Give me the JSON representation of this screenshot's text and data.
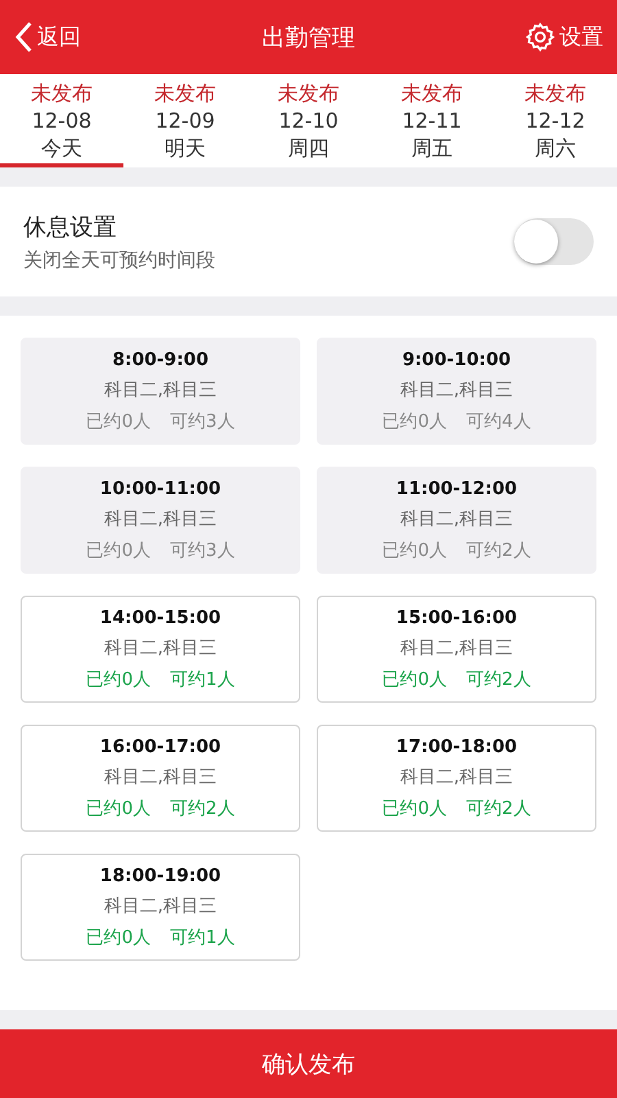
{
  "header": {
    "back": "返回",
    "title": "出勤管理",
    "settings": "设置"
  },
  "days": [
    {
      "status": "未发布",
      "date": "12-08",
      "weekday": "今天",
      "selected": true
    },
    {
      "status": "未发布",
      "date": "12-09",
      "weekday": "明天",
      "selected": false
    },
    {
      "status": "未发布",
      "date": "12-10",
      "weekday": "周四",
      "selected": false
    },
    {
      "status": "未发布",
      "date": "12-11",
      "weekday": "周五",
      "selected": false
    },
    {
      "status": "未发布",
      "date": "12-12",
      "weekday": "周六",
      "selected": false
    }
  ],
  "rest": {
    "title": "休息设置",
    "subtitle": "关闭全天可预约时间段",
    "on": false
  },
  "slots": [
    {
      "time": "8:00-9:00",
      "subjects": "科目二,科目三",
      "booked": "已约0人",
      "available": "可约3人",
      "disabled": true
    },
    {
      "time": "9:00-10:00",
      "subjects": "科目二,科目三",
      "booked": "已约0人",
      "available": "可约4人",
      "disabled": true
    },
    {
      "time": "10:00-11:00",
      "subjects": "科目二,科目三",
      "booked": "已约0人",
      "available": "可约3人",
      "disabled": true
    },
    {
      "time": "11:00-12:00",
      "subjects": "科目二,科目三",
      "booked": "已约0人",
      "available": "可约2人",
      "disabled": true
    },
    {
      "time": "14:00-15:00",
      "subjects": "科目二,科目三",
      "booked": "已约0人",
      "available": "可约1人",
      "disabled": false
    },
    {
      "time": "15:00-16:00",
      "subjects": "科目二,科目三",
      "booked": "已约0人",
      "available": "可约2人",
      "disabled": false
    },
    {
      "time": "16:00-17:00",
      "subjects": "科目二,科目三",
      "booked": "已约0人",
      "available": "可约2人",
      "disabled": false
    },
    {
      "time": "17:00-18:00",
      "subjects": "科目二,科目三",
      "booked": "已约0人",
      "available": "可约2人",
      "disabled": false
    },
    {
      "time": "18:00-19:00",
      "subjects": "科目二,科目三",
      "booked": "已约0人",
      "available": "可约1人",
      "disabled": false
    }
  ],
  "publish_button": "确认发布"
}
